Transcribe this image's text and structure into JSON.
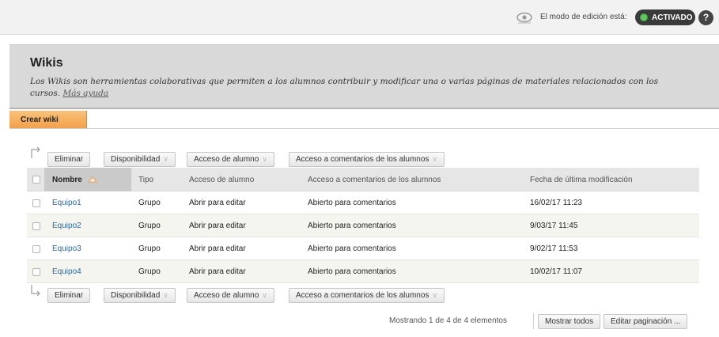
{
  "topbar": {
    "edit_mode_label": "El modo de edición está:",
    "edit_mode_state": "ACTIVADO",
    "help": "?",
    "icons": {
      "preview": "eye-icon",
      "help": "help-icon"
    }
  },
  "header": {
    "title": "Wikis",
    "description": "Los Wikis son herramientas colaborativas que permiten a los alumnos contribuir y modificar una o varias páginas de materiales relacionados con los cursos.",
    "help_link": "Más ayuda"
  },
  "actionbar": {
    "create_label": "Crear wiki"
  },
  "list_actions": {
    "delete": "Eliminar",
    "availability": "Disponibilidad",
    "student_access": "Acceso de alumno",
    "comment_access": "Acceso a comentarios de los alumnos"
  },
  "table": {
    "columns": [
      "Nombre",
      "Tipo",
      "Acceso de alumno",
      "Acceso a comentarios de los alumnos",
      "Fecha de última modificación"
    ],
    "rows": [
      {
        "name": "Equipo1",
        "type": "Grupo",
        "access": "Abrir para editar",
        "comments": "Abierto para comentarios",
        "date": "16/02/17 11:23"
      },
      {
        "name": "Equipo2",
        "type": "Grupo",
        "access": "Abrir para editar",
        "comments": "Abierto para comentarios",
        "date": "9/03/17 11:45"
      },
      {
        "name": "Equipo3",
        "type": "Grupo",
        "access": "Abrir para editar",
        "comments": "Abierto para comentarios",
        "date": "9/02/17 11:53"
      },
      {
        "name": "Equipo4",
        "type": "Grupo",
        "access": "Abrir para editar",
        "comments": "Abierto para comentarios",
        "date": "10/02/17 11:07"
      }
    ]
  },
  "pagination": {
    "summary": "Mostrando 1 de 4 de 4 elementos",
    "show_all": "Mostrar todos",
    "edit_paging": "Editar paginación ..."
  },
  "colors": {
    "accent": "#f3a04a",
    "active_dot": "#5cc85c",
    "link": "#2c6aa0"
  }
}
